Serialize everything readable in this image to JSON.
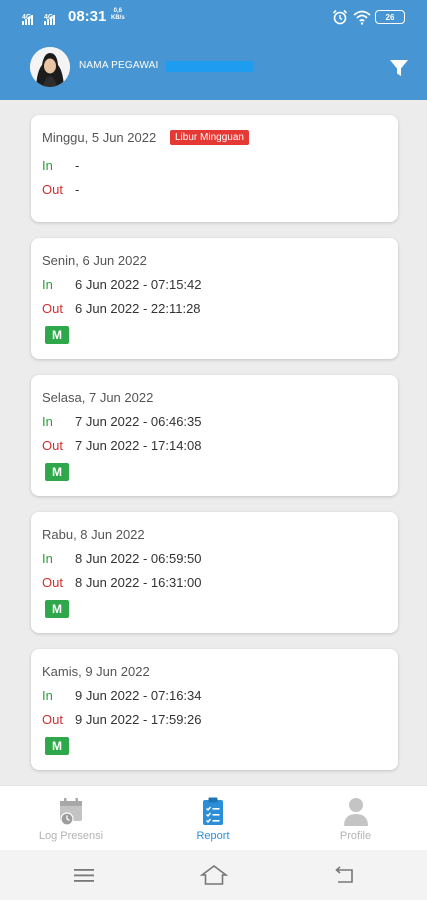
{
  "status_bar": {
    "network_1": "4G",
    "network_2": "4G",
    "time": "08:31",
    "speed_value": "0,6",
    "speed_unit": "KB/s",
    "battery": "26"
  },
  "header": {
    "employee_name": "NAMA PEGAWAI",
    "filter_icon": "filter-icon",
    "colors": {
      "header_bg": "#4796d3"
    }
  },
  "attendance": [
    {
      "date": "Minggu, 5 Jun 2022",
      "holiday_label": "Libur Mingguan",
      "in_label": "In",
      "in_value": "-",
      "out_label": "Out",
      "out_value": "-",
      "status": ""
    },
    {
      "date": "Senin, 6 Jun 2022",
      "holiday_label": "",
      "in_label": "In",
      "in_value": "6 Jun 2022 - 07:15:42",
      "out_label": "Out",
      "out_value": "6 Jun 2022 - 22:11:28",
      "status": "M"
    },
    {
      "date": "Selasa, 7 Jun 2022",
      "holiday_label": "",
      "in_label": "In",
      "in_value": "7 Jun 2022 - 06:46:35",
      "out_label": "Out",
      "out_value": "7 Jun 2022 - 17:14:08",
      "status": "M"
    },
    {
      "date": "Rabu, 8 Jun 2022",
      "holiday_label": "",
      "in_label": "In",
      "in_value": "8 Jun 2022 - 06:59:50",
      "out_label": "Out",
      "out_value": "8 Jun 2022 - 16:31:00",
      "status": "M"
    },
    {
      "date": "Kamis, 9 Jun 2022",
      "holiday_label": "",
      "in_label": "In",
      "in_value": "9 Jun 2022 - 07:16:34",
      "out_label": "Out",
      "out_value": "9 Jun 2022 - 17:59:26",
      "status": "M"
    }
  ],
  "bottom_nav": {
    "items": [
      {
        "label": "Log Presensi",
        "icon": "calendar-clock-icon",
        "active": false
      },
      {
        "label": "Report",
        "icon": "clipboard-checklist-icon",
        "active": true
      },
      {
        "label": "Profile",
        "icon": "person-icon",
        "active": false
      }
    ],
    "colors": {
      "active": "#2b8ed6",
      "inactive": "#b3b3b3"
    }
  },
  "system_nav": {
    "icons": [
      "menu-icon",
      "home-icon",
      "back-icon"
    ]
  }
}
